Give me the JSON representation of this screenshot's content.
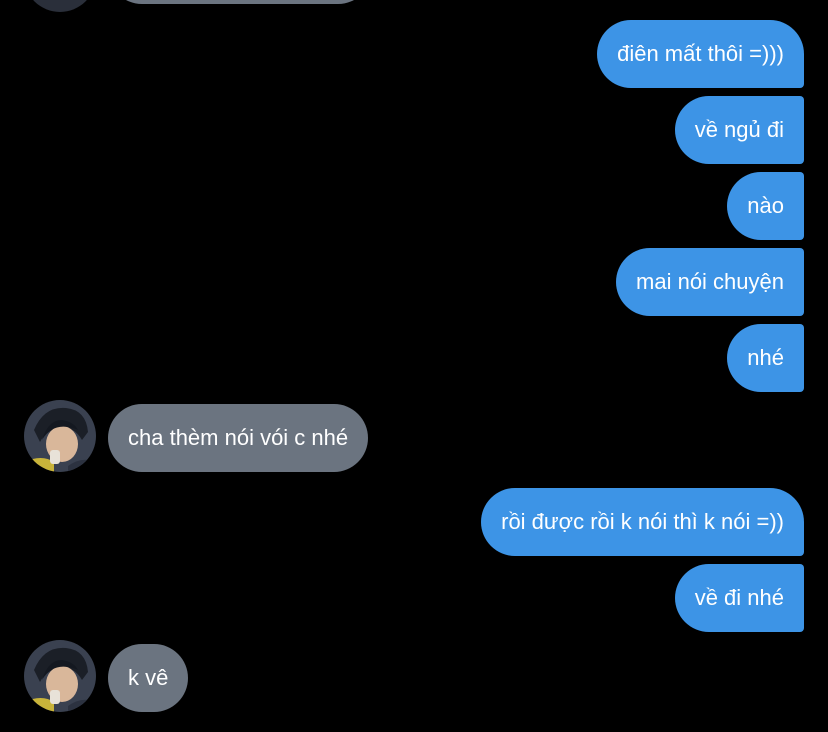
{
  "colors": {
    "background": "#000000",
    "outgoing_bubble": "#3d94e6",
    "incoming_bubble": "#6b7480",
    "text": "#ffffff"
  },
  "messages": [
    {
      "direction": "incoming",
      "text": ""
    },
    {
      "direction": "outgoing",
      "text": "điên mất thôi =)))"
    },
    {
      "direction": "outgoing",
      "text": "về ngủ đi"
    },
    {
      "direction": "outgoing",
      "text": "nào"
    },
    {
      "direction": "outgoing",
      "text": "mai nói chuyện"
    },
    {
      "direction": "outgoing",
      "text": "nhé"
    },
    {
      "direction": "incoming",
      "text": "cha thèm nói vói c nhé",
      "avatar": "user-avatar"
    },
    {
      "direction": "outgoing",
      "text": "rồi được rồi k nói thì k nói =))"
    },
    {
      "direction": "outgoing",
      "text": "về đi nhé"
    },
    {
      "direction": "incoming",
      "text": "k vê",
      "avatar": "user-avatar"
    }
  ]
}
